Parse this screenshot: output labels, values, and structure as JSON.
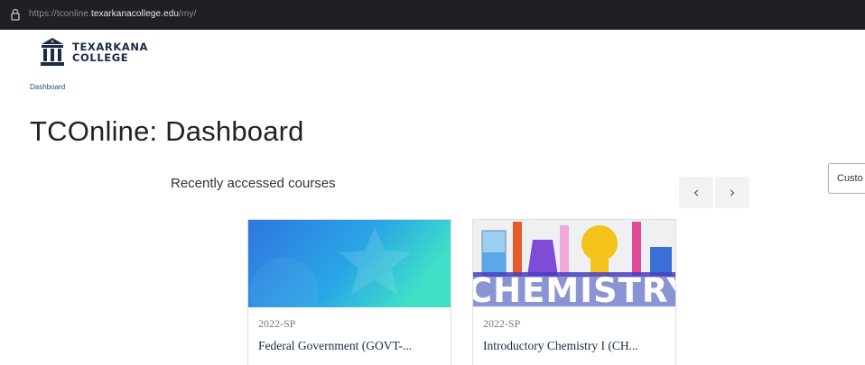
{
  "browser": {
    "url_prefix": "https://tconline.",
    "url_host": "texarkanacollege.edu",
    "url_path": "/my/"
  },
  "logo": {
    "line1": "TEXARKANA",
    "line2": "COLLEGE"
  },
  "breadcrumb": "Dashboard",
  "page_title": "TCOnline: Dashboard",
  "customise_button": "Custo",
  "recent_courses": {
    "heading": "Recently accessed courses",
    "prev_label": "‹",
    "next_label": "›",
    "courses": [
      {
        "term": "2022-SP",
        "name": "Federal Government (GOVT-...",
        "image": "blue-gradient-star"
      },
      {
        "term": "2022-SP",
        "name": "Introductory Chemistry I (CH...",
        "image": "chemistry-glassware",
        "image_text": "CHEMISTRY"
      }
    ]
  },
  "colors": {
    "accent": "#1e4a7a",
    "card_blue_from": "#2f76e0",
    "card_blue_to": "#39d9c8"
  }
}
